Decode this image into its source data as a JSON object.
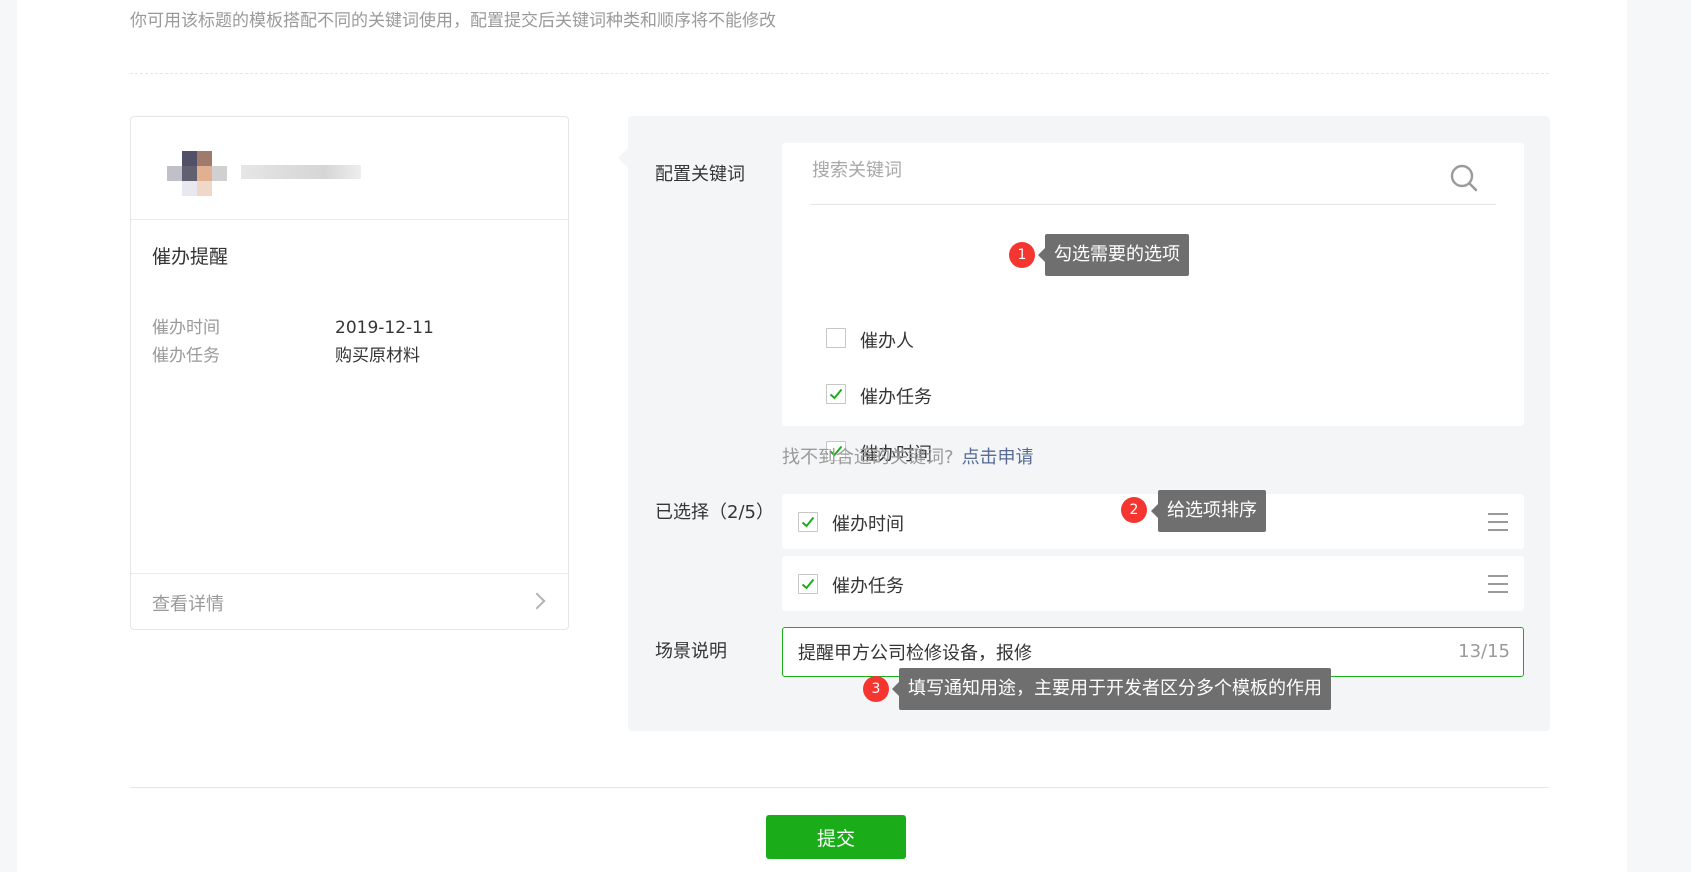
{
  "hint": "你可用该标题的模板搭配不同的关键词使用，配置提交后关键词种类和顺序将不能修改",
  "preview": {
    "title": "催办提醒",
    "fields": [
      {
        "key": "催办时间",
        "value": "2019-12-11"
      },
      {
        "key": "催办任务",
        "value": "购买原材料"
      }
    ],
    "view_detail": "查看详情"
  },
  "config": {
    "keywords_label": "配置关键词",
    "search_placeholder": "搜索关键词",
    "keywords": [
      {
        "label": "催办人",
        "checked": false
      },
      {
        "label": "催办任务",
        "checked": true
      },
      {
        "label": "催办时间",
        "checked": true
      }
    ],
    "cant_find": "找不到合适的关键词?",
    "apply_link": "点击申请",
    "selected_label": "已选择（2/5）",
    "selected": [
      {
        "label": "催办时间"
      },
      {
        "label": "催办任务"
      }
    ],
    "scene_label": "场景说明",
    "scene_value": "提醒甲方公司检修设备，报修",
    "scene_counter": "13/15"
  },
  "tips": [
    {
      "num": "1",
      "text": "勾选需要的选项"
    },
    {
      "num": "2",
      "text": "给选项排序"
    },
    {
      "num": "3",
      "text": "填写通知用途，主要用于开发者区分多个模板的作用"
    }
  ],
  "submit_label": "提交",
  "colors": {
    "accent": "#1aad19",
    "link": "#576b95",
    "badge": "#f43530",
    "tooltip": "#6f6f6f"
  }
}
